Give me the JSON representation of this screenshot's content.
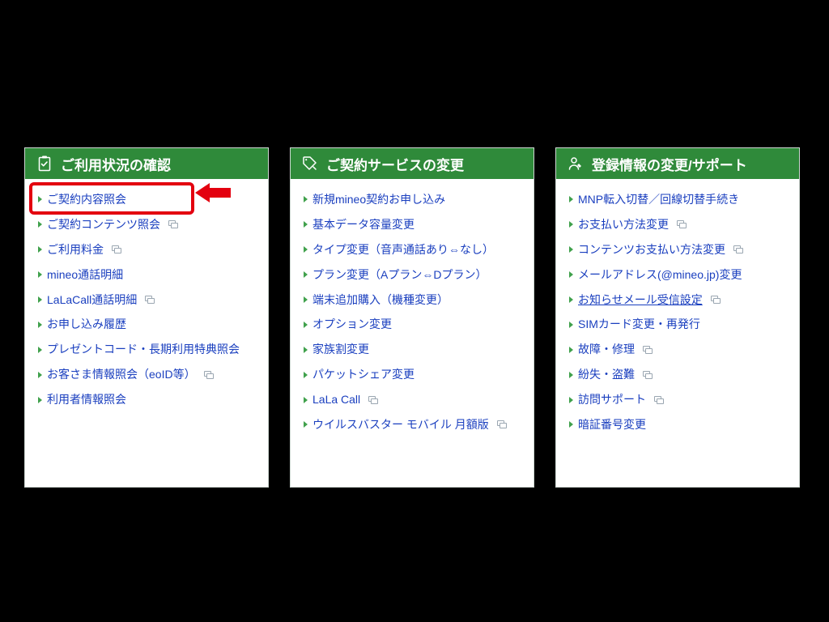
{
  "colors": {
    "brand_green": "#2f8a3a",
    "link_blue": "#1a3fbf",
    "highlight_red": "#e3000f"
  },
  "panels": [
    {
      "id": "usage",
      "title": "ご利用状況の確認",
      "icon": "clipboard-check-icon",
      "items": [
        {
          "label": "ご契約内容照会",
          "ext": false,
          "highlighted": true
        },
        {
          "label": "ご契約コンテンツ照会",
          "ext": true
        },
        {
          "label": "ご利用料金",
          "ext": true
        },
        {
          "label": "mineo通話明細",
          "ext": false
        },
        {
          "label": "LaLaCall通話明細",
          "ext": true
        },
        {
          "label": "お申し込み履歴",
          "ext": false
        },
        {
          "label": "プレゼントコード・長期利用特典照会",
          "ext": false
        },
        {
          "label": "お客さま情報照会（eoID等）",
          "ext": true
        },
        {
          "label": "利用者情報照会",
          "ext": false
        }
      ]
    },
    {
      "id": "service",
      "title": "ご契約サービスの変更",
      "icon": "tag-writing-icon",
      "items": [
        {
          "label": "新規mineo契約お申し込み",
          "ext": false
        },
        {
          "label": "基本データ容量変更",
          "ext": false
        },
        {
          "label": "タイプ変更（音声通話あり⇔なし）",
          "ext": false
        },
        {
          "label": "プラン変更（Aプラン⇔Dプラン）",
          "ext": false
        },
        {
          "label": "端末追加購入（機種変更）",
          "ext": false
        },
        {
          "label": "オプション変更",
          "ext": false
        },
        {
          "label": "家族割変更",
          "ext": false
        },
        {
          "label": "パケットシェア変更",
          "ext": false
        },
        {
          "label": "LaLa Call",
          "ext": true
        },
        {
          "label": "ウイルスバスター モバイル 月額版",
          "ext": true
        }
      ]
    },
    {
      "id": "account",
      "title": "登録情報の変更/サポート",
      "icon": "user-edit-icon",
      "items": [
        {
          "label": "MNP転入切替／回線切替手続き",
          "ext": false
        },
        {
          "label": "お支払い方法変更",
          "ext": true
        },
        {
          "label": "コンテンツお支払い方法変更",
          "ext": true
        },
        {
          "label": "メールアドレス(@mineo.jp)変更",
          "ext": false
        },
        {
          "label": "お知らせメール受信設定",
          "ext": true,
          "underlined": true
        },
        {
          "label": "SIMカード変更・再発行",
          "ext": false
        },
        {
          "label": "故障・修理",
          "ext": true
        },
        {
          "label": "紛失・盗難",
          "ext": true
        },
        {
          "label": "訪問サポート",
          "ext": true
        },
        {
          "label": "暗証番号変更",
          "ext": false
        }
      ]
    }
  ]
}
